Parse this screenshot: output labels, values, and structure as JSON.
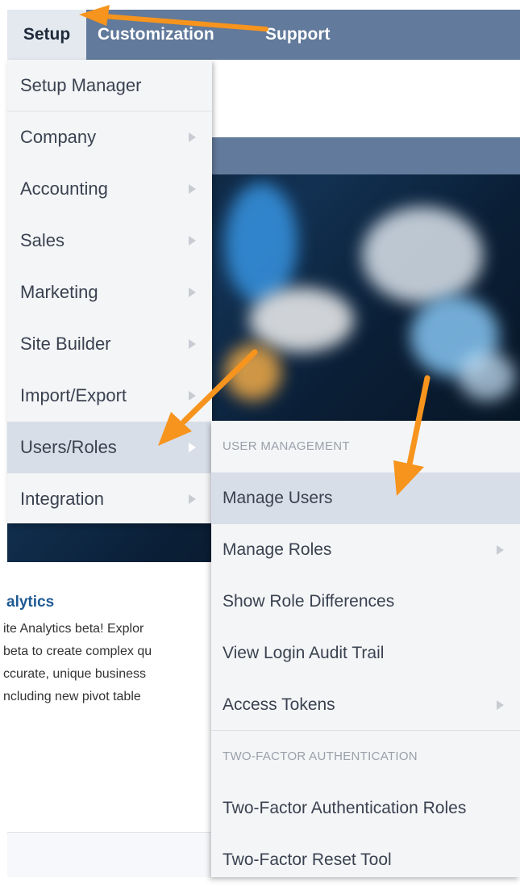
{
  "topnav": {
    "setup": "Setup",
    "customization": "Customization",
    "support": "Support"
  },
  "setup_menu": {
    "items": [
      {
        "label": "Setup Manager",
        "has_submenu": false
      },
      {
        "label": "Company",
        "has_submenu": true
      },
      {
        "label": "Accounting",
        "has_submenu": true
      },
      {
        "label": "Sales",
        "has_submenu": true
      },
      {
        "label": "Marketing",
        "has_submenu": true
      },
      {
        "label": "Site Builder",
        "has_submenu": true
      },
      {
        "label": "Import/Export",
        "has_submenu": true
      },
      {
        "label": "Users/Roles",
        "has_submenu": true,
        "active": true
      },
      {
        "label": "Integration",
        "has_submenu": true
      }
    ]
  },
  "users_roles_menu": {
    "section_user_management": "USER MANAGEMENT",
    "manage_users": "Manage Users",
    "manage_roles": "Manage Roles",
    "show_role_differences": "Show Role Differences",
    "view_login_audit_trail": "View Login Audit Trail",
    "access_tokens": "Access Tokens",
    "section_two_factor": "TWO-FACTOR AUTHENTICATION",
    "two_factor_roles": "Two-Factor Authentication Roles",
    "two_factor_reset": "Two-Factor Reset Tool"
  },
  "background": {
    "analytics_title": "alytics",
    "analytics_lines": [
      "ite Analytics beta! Explor",
      "beta to create complex qu",
      "ccurate, unique business",
      "ncluding new pivot table"
    ]
  },
  "colors": {
    "nav_bar": "#627a9b",
    "menu_bg": "#f4f5f7",
    "menu_active": "#d8dee8",
    "annotation_arrow": "#f7941d",
    "link_blue": "#1f5a94"
  }
}
